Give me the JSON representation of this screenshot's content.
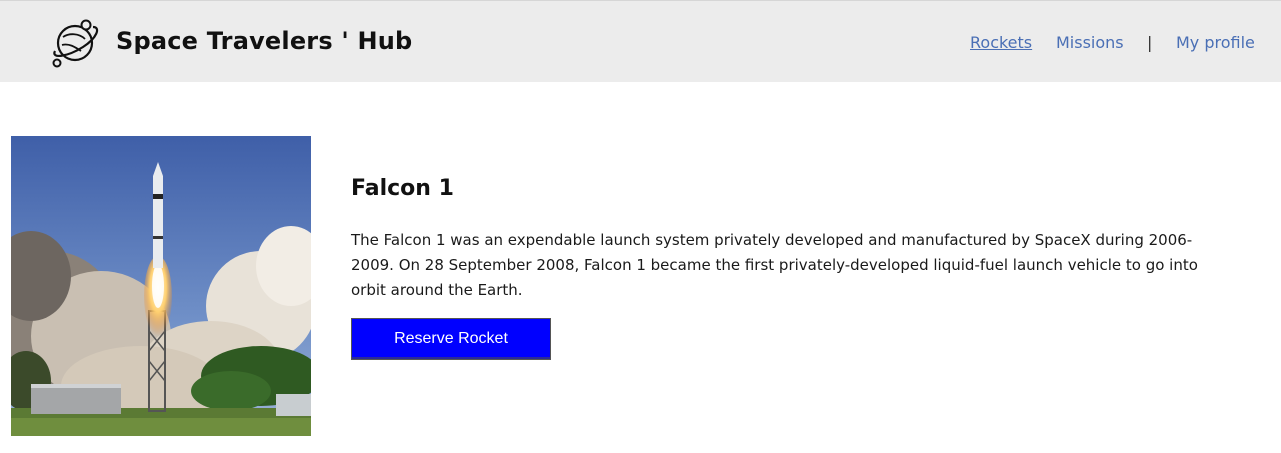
{
  "header": {
    "brand": "Space Travelers ' Hub",
    "logo_icon": "planet-icon",
    "nav": {
      "rockets": "Rockets",
      "missions": "Missions",
      "separator": "|",
      "profile": "My profile"
    },
    "active_nav": "Rockets",
    "link_color": "#4a6fb5"
  },
  "rocket": {
    "name": "Falcon 1",
    "description": " The Falcon 1 was an expendable launch system privately developed and manufactured by SpaceX during 2006-2009. On 28 September 2008, Falcon 1 became the first privately-developed liquid-fuel launch vehicle to go into orbit around the Earth.",
    "reserve_label": "Reserve Rocket",
    "button_color": "#0000ff"
  }
}
